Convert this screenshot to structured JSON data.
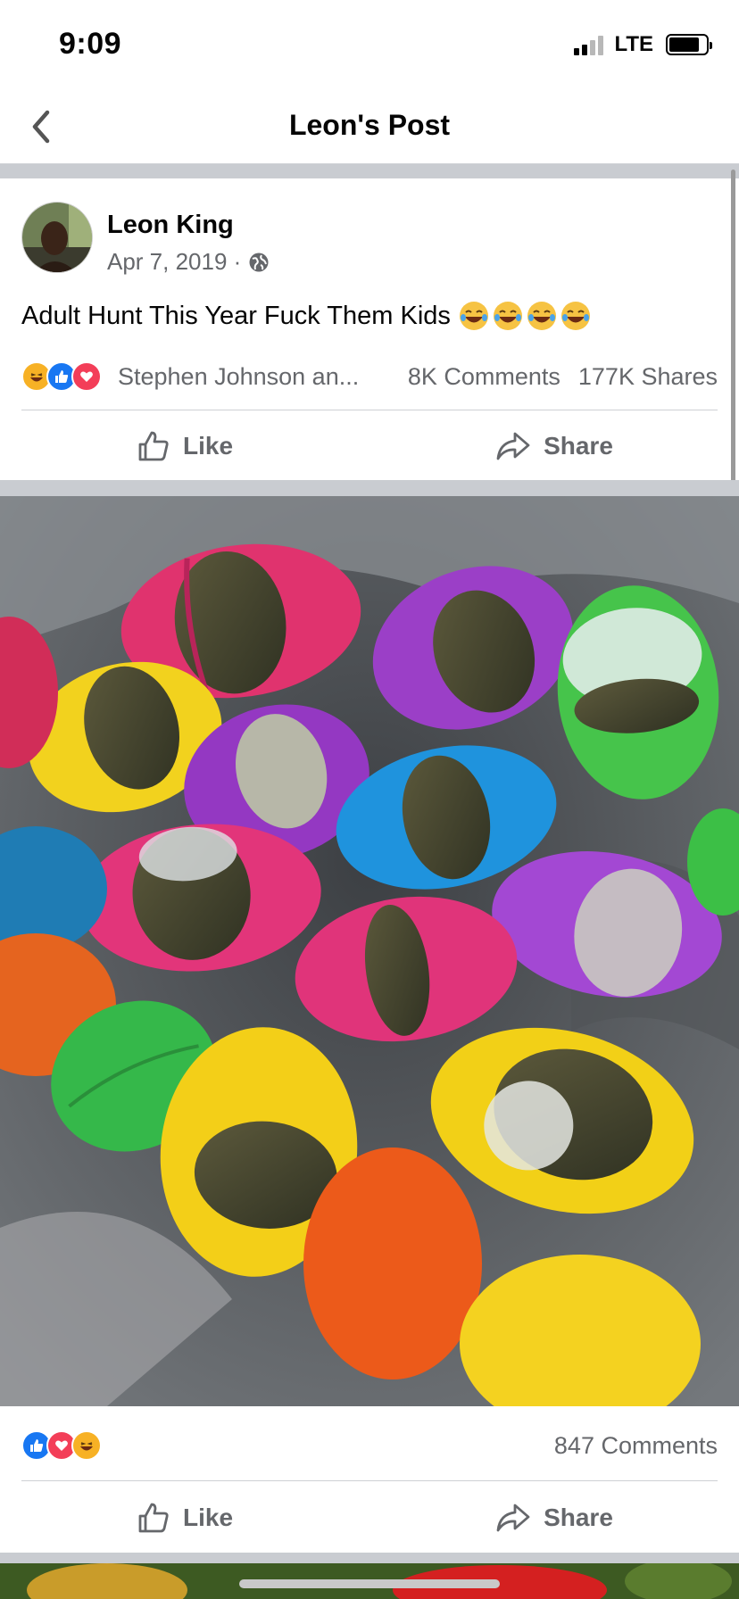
{
  "status_bar": {
    "time": "9:09",
    "network": "LTE"
  },
  "header": {
    "title": "Leon's Post"
  },
  "post": {
    "author": "Leon King",
    "date": "Apr 7, 2019 ·",
    "text": "Adult Hunt This Year Fuck Them Kids",
    "text_emoji": [
      "face-with-tears-of-joy",
      "face-with-tears-of-joy",
      "face-with-tears-of-joy",
      "face-with-tears-of-joy"
    ],
    "reaction_icons": [
      "haha-icon",
      "like-icon",
      "love-icon"
    ],
    "reactors": "Stephen Johnson an...",
    "comments": "8K Comments",
    "shares": "177K Shares",
    "actions": {
      "like": "Like",
      "share": "Share"
    }
  },
  "photo_post": {
    "reaction_icons": [
      "like-icon",
      "love-icon",
      "haha-icon"
    ],
    "comments": "847 Comments",
    "actions": {
      "like": "Like",
      "share": "Share"
    }
  },
  "colors": {
    "like_blue": "#1877f2",
    "love_red": "#f33e58",
    "haha_yellow": "#f7b125",
    "secondary_text": "#65676b",
    "separator": "#c9ccd1"
  }
}
